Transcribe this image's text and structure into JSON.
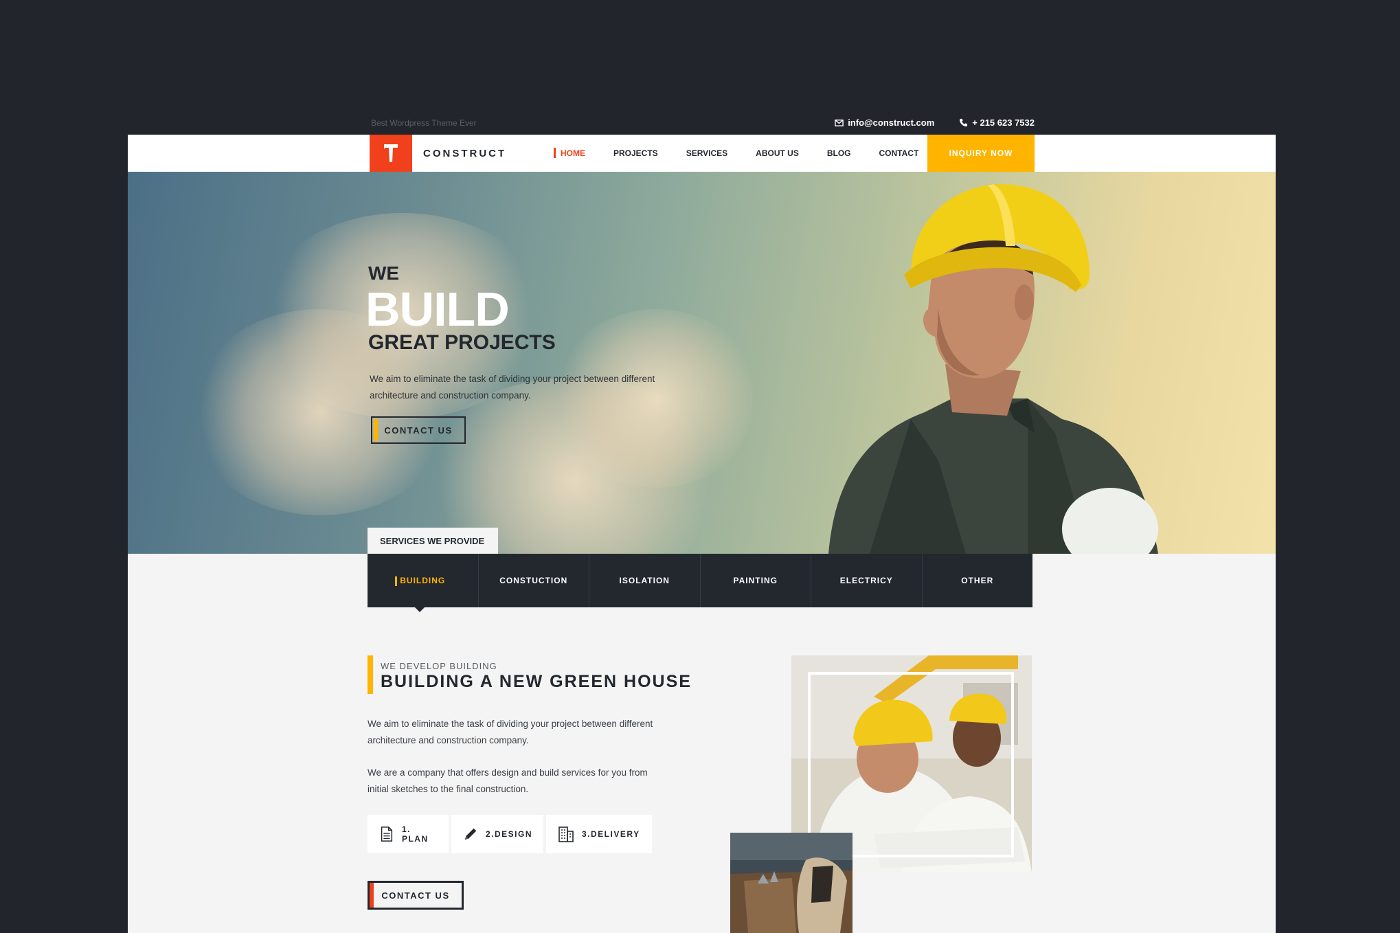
{
  "topbar": {
    "tagline": "Best Wordpress Theme Ever",
    "email": "info@construct.com",
    "phone": "+ 215 623 7532"
  },
  "header": {
    "brand": "CONSTRUCT",
    "nav": [
      "HOME",
      "PROJECTS",
      "SERVICES",
      "ABOUT US",
      "BLOG",
      "CONTACT"
    ],
    "inquiry": "INQUIRY NOW"
  },
  "hero": {
    "line1": "WE",
    "line2": "BUILD",
    "line3": "GREAT PROJECTS",
    "description": "We aim to eliminate the task of dividing your project between different architecture and construction company.",
    "button": "CONTACT US"
  },
  "services": {
    "label": "SERVICES WE PROVIDE",
    "tabs": [
      "BUILDING",
      "CONSTUCTION",
      "ISOLATION",
      "PAINTING",
      "ELECTRICY",
      "OTHER"
    ]
  },
  "content": {
    "kicker": "WE DEVELOP BUILDING",
    "title": "BUILDING A NEW GREEN HOUSE",
    "para1": "We aim to eliminate the task of dividing your project between different architecture and construction company.",
    "para2": "We are a company that offers design and build services for you from initial sketches to the final construction.",
    "steps": [
      "1. PLAN",
      "2.DESIGN",
      "3.DELIVERY"
    ],
    "button": "CONTACT US"
  },
  "colors": {
    "accent_red": "#f0401c",
    "accent_yellow": "#ffb400",
    "dark": "#23272e"
  }
}
